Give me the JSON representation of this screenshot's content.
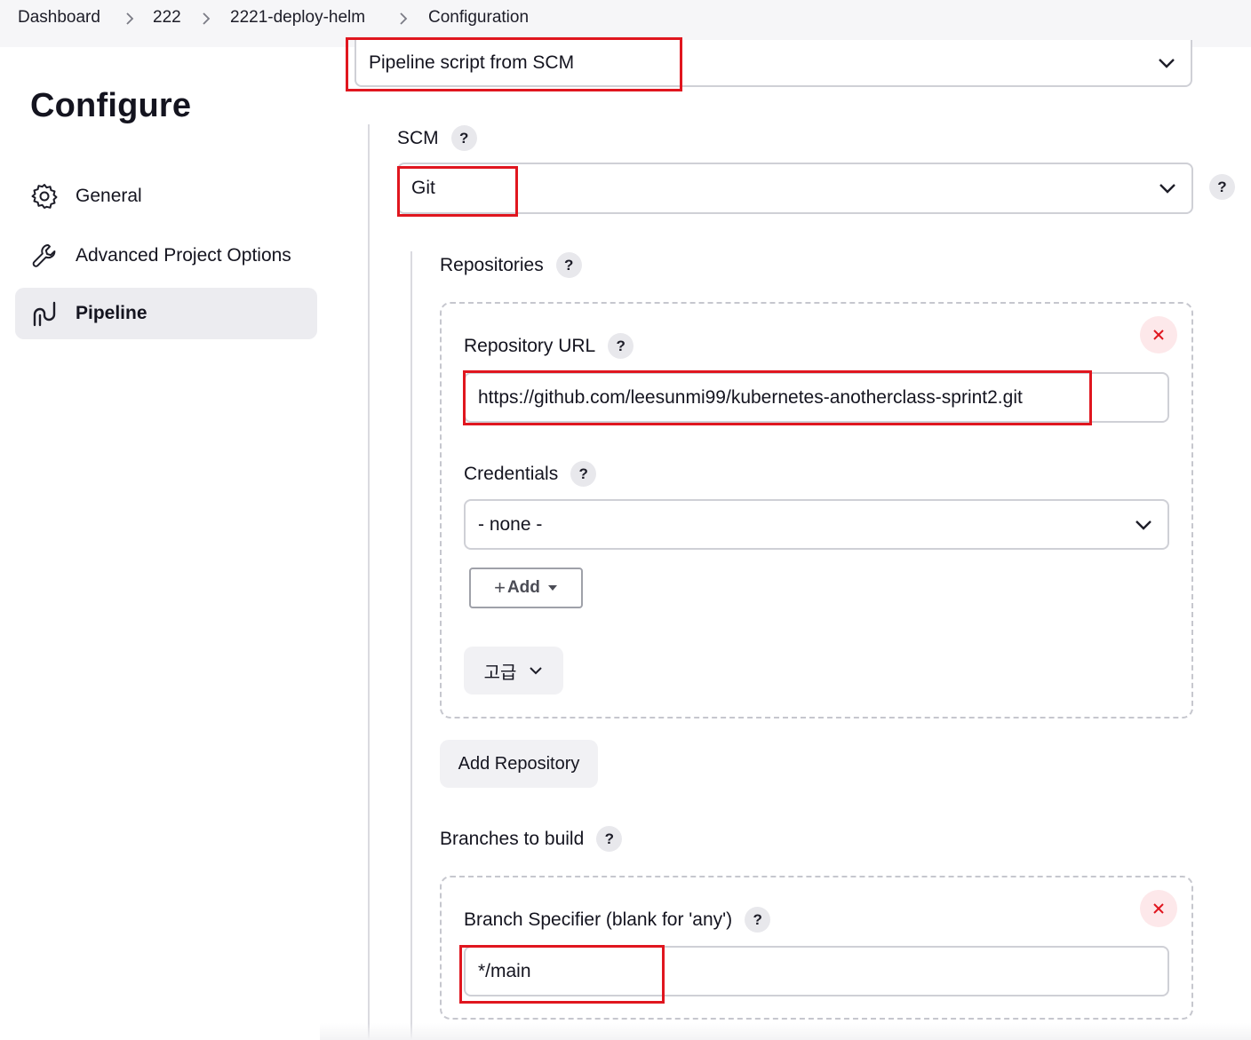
{
  "breadcrumb": {
    "items": [
      "Dashboard",
      "222",
      "2221-deploy-helm",
      "Configuration"
    ]
  },
  "sidebar": {
    "title": "Configure",
    "items": [
      {
        "label": "General",
        "icon": "gear-icon"
      },
      {
        "label": "Advanced Project Options",
        "icon": "wrench-icon"
      },
      {
        "label": "Pipeline",
        "icon": "pipeline-icon",
        "active": true
      }
    ]
  },
  "pipeline": {
    "definition_value": "Pipeline script from SCM",
    "scm_label": "SCM",
    "scm_value": "Git",
    "help_glyph": "?",
    "repositories": {
      "label": "Repositories",
      "url_label": "Repository URL",
      "url_value": "https://github.com/leesunmi99/kubernetes-anotherclass-sprint2.git",
      "credentials_label": "Credentials",
      "credentials_value": "- none -",
      "add_label": "Add",
      "advanced_label": "고급",
      "add_repository_label": "Add Repository"
    },
    "branches": {
      "label": "Branches to build",
      "specifier_label": "Branch Specifier (blank for 'any')",
      "specifier_value": "*/main"
    }
  },
  "colors": {
    "highlight": "#e0161f",
    "close_icon": "#e0161f",
    "active_item_bg": "#ececf0"
  }
}
